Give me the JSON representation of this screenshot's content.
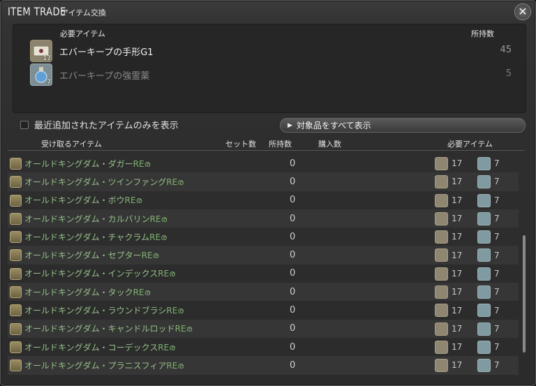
{
  "window": {
    "title": "ITEM TRADE",
    "subtitle": "アイテム交換",
    "close_glyph": "✕"
  },
  "required_panel": {
    "header_item": "必要アイテム",
    "header_owned": "所持数",
    "items": [
      {
        "name": "エバーキープの手形G1",
        "owned": "45",
        "badge": "17",
        "icon": "token-icon",
        "dim": false
      },
      {
        "name": "エバーキープの強霊薬",
        "owned": "5",
        "badge": "7",
        "icon": "potion-icon",
        "dim": true
      }
    ]
  },
  "filter": {
    "checkbox_label": "最近追加されたアイテムのみを表示",
    "show_all_button": "対象品をすべて表示"
  },
  "list_headers": {
    "receive_item": "受け取るアイテム",
    "set_count": "セット数",
    "owned": "所持数",
    "purchase": "購入数",
    "required_items": "必要アイテム"
  },
  "rows": [
    {
      "name": "オールドキングダム・ダガー",
      "suffix": "RE",
      "owned": "0",
      "mat_a": "17",
      "mat_b": "7",
      "icon": "dagger-icon"
    },
    {
      "name": "オールドキングダム・ツインファング",
      "suffix": "RE",
      "owned": "0",
      "mat_a": "17",
      "mat_b": "7",
      "icon": "twinfang-icon"
    },
    {
      "name": "オールドキングダム・ボウ",
      "suffix": "RE",
      "owned": "0",
      "mat_a": "17",
      "mat_b": "7",
      "icon": "bow-icon"
    },
    {
      "name": "オールドキングダム・カルバリン",
      "suffix": "RE",
      "owned": "0",
      "mat_a": "17",
      "mat_b": "7",
      "icon": "gun-icon"
    },
    {
      "name": "オールドキングダム・チャクラム",
      "suffix": "RE",
      "owned": "0",
      "mat_a": "17",
      "mat_b": "7",
      "icon": "chakram-icon"
    },
    {
      "name": "オールドキングダム・セプター",
      "suffix": "RE",
      "owned": "0",
      "mat_a": "17",
      "mat_b": "7",
      "icon": "scepter-icon"
    },
    {
      "name": "オールドキングダム・インデックス",
      "suffix": "RE",
      "owned": "0",
      "mat_a": "17",
      "mat_b": "7",
      "icon": "staff-icon"
    },
    {
      "name": "オールドキングダム・タック",
      "suffix": "RE",
      "owned": "0",
      "mat_a": "17",
      "mat_b": "7",
      "icon": "rapier-icon"
    },
    {
      "name": "オールドキングダム・ラウンドブラシ",
      "suffix": "RE",
      "owned": "0",
      "mat_a": "17",
      "mat_b": "7",
      "icon": "brush-icon"
    },
    {
      "name": "オールドキングダム・キャンドルロッド",
      "suffix": "RE",
      "owned": "0",
      "mat_a": "17",
      "mat_b": "7",
      "icon": "rod-icon"
    },
    {
      "name": "オールドキングダム・コーデックス",
      "suffix": "RE",
      "owned": "0",
      "mat_a": "17",
      "mat_b": "7",
      "icon": "codex-icon"
    },
    {
      "name": "オールドキングダム・プラニスフィア",
      "suffix": "RE",
      "owned": "0",
      "mat_a": "17",
      "mat_b": "7",
      "icon": "planisphere-icon"
    }
  ],
  "colors": {
    "item_name": "#96c08a",
    "dim_text": "#8a8a8a"
  }
}
